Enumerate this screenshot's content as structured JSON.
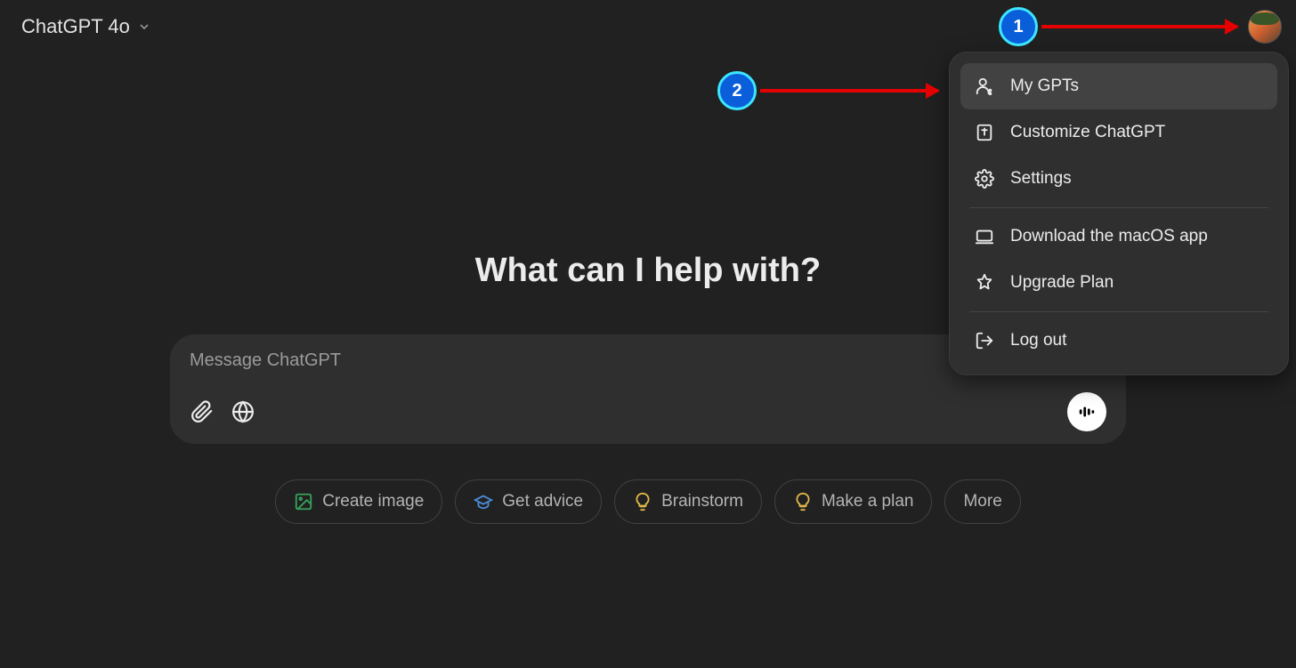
{
  "header": {
    "model_label": "ChatGPT 4o"
  },
  "main": {
    "title": "What can I help with?",
    "composer": {
      "placeholder": "Message ChatGPT"
    },
    "chips": [
      {
        "label": "Create image",
        "icon_color": "#35a35a"
      },
      {
        "label": "Get advice",
        "icon_color": "#4a8bd6"
      },
      {
        "label": "Brainstorm",
        "icon_color": "#e3b84a"
      },
      {
        "label": "Make a plan",
        "icon_color": "#e3b84a"
      },
      {
        "label": "More",
        "icon_color": ""
      }
    ]
  },
  "menu": {
    "items": [
      {
        "label": "My GPTs",
        "icon": "user-gpt",
        "hovered": true
      },
      {
        "label": "Customize ChatGPT",
        "icon": "customize",
        "hovered": false
      },
      {
        "label": "Settings",
        "icon": "gear",
        "hovered": false
      }
    ],
    "items2": [
      {
        "label": "Download the macOS app",
        "icon": "laptop"
      },
      {
        "label": "Upgrade Plan",
        "icon": "upgrade"
      }
    ],
    "items3": [
      {
        "label": "Log out",
        "icon": "logout"
      }
    ]
  },
  "annotations": {
    "callout1": "1",
    "callout2": "2"
  }
}
